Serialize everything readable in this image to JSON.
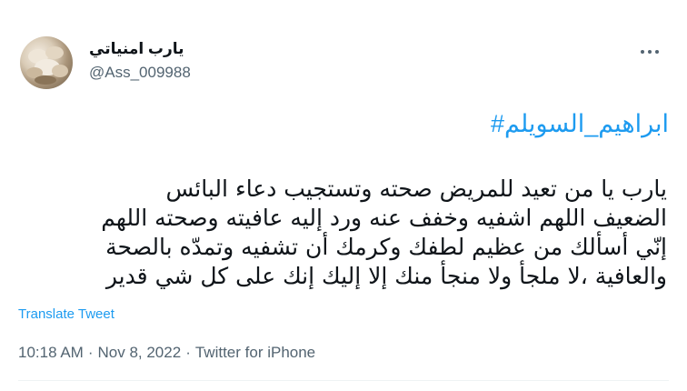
{
  "user": {
    "display_name": "يارب امنياتي",
    "handle": "@Ass_009988"
  },
  "tweet": {
    "hashtag": "#ابراهيم_السويلم",
    "lines": [
      "يارب يا من تعيد للمريض صحته وتستجيب دعاء البائس",
      "الضعيف اللهم اشفيه وخفف عنه ورد إليه عافيته وصحته اللهم",
      "إنّي أسألك من عظيم لطفك وكرمك أن تشفيه وتمدّه بالصحة",
      "والعافية ،لا ملجأ ولا منجأ منك إلا إليك إنك على كل شي قدير"
    ],
    "translate_label": "Translate Tweet"
  },
  "meta": {
    "time": "10:18 AM",
    "separator": "·",
    "date": "Nov 8, 2022",
    "source": "Twitter for iPhone"
  },
  "icons": {
    "more": "more-horizontal-icon"
  },
  "colors": {
    "link": "#1d9bf0",
    "secondary": "#536471",
    "text": "#0f1419"
  }
}
